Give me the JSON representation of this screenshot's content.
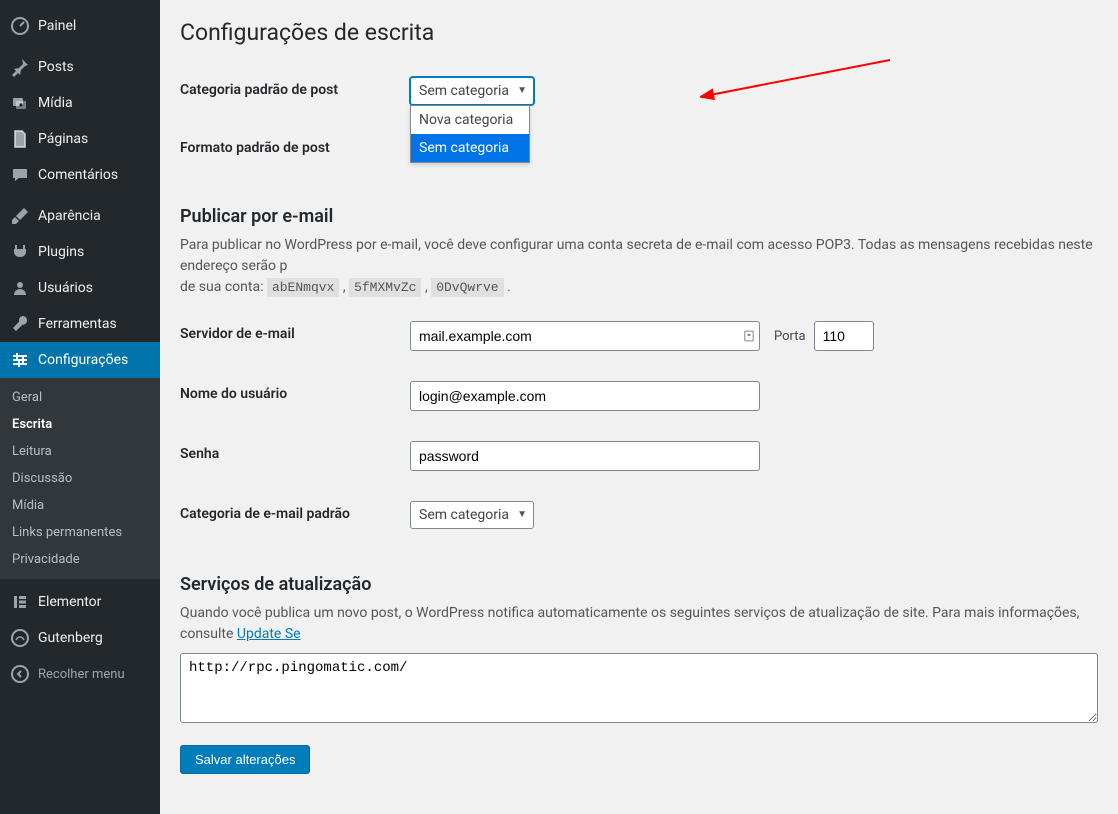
{
  "sidebar": {
    "items": [
      {
        "label": "Painel",
        "icon": "dashboard-icon"
      },
      {
        "label": "Posts",
        "icon": "pin-icon"
      },
      {
        "label": "Mídia",
        "icon": "media-icon"
      },
      {
        "label": "Páginas",
        "icon": "page-icon"
      },
      {
        "label": "Comentários",
        "icon": "comments-icon"
      },
      {
        "label": "Aparência",
        "icon": "brush-icon"
      },
      {
        "label": "Plugins",
        "icon": "plug-icon"
      },
      {
        "label": "Usuários",
        "icon": "users-icon"
      },
      {
        "label": "Ferramentas",
        "icon": "tools-icon"
      },
      {
        "label": "Configurações",
        "icon": "settings-icon",
        "current": true
      },
      {
        "label": "Elementor",
        "icon": "elementor-icon"
      },
      {
        "label": "Gutenberg",
        "icon": "gutenberg-icon"
      }
    ],
    "submenu": [
      "Geral",
      "Escrita",
      "Leitura",
      "Discussão",
      "Mídia",
      "Links permanentes",
      "Privacidade"
    ],
    "submenu_current": "Escrita",
    "collapse_label": "Recolher menu"
  },
  "page": {
    "title": "Configurações de escrita",
    "row1_label": "Categoria padrão de post",
    "row2_label": "Formato padrão de post",
    "default_category_selected": "Sem categoria",
    "default_category_options": [
      "Nova categoria",
      "Sem categoria"
    ],
    "section_email_title": "Publicar por e-mail",
    "section_email_desc_prefix": "Para publicar no WordPress por e-mail, você deve configurar uma conta secreta de e-mail com acesso POP3. Todas as mensagens recebidas neste endereço serão p",
    "section_email_desc_middle": "de sua conta:",
    "random_codes": [
      "abENmqvx",
      "5fMXMvZc",
      "0DvQwrve"
    ],
    "row_server_label": "Servidor de e-mail",
    "server_value": "mail.example.com",
    "port_label": "Porta",
    "port_value": "110",
    "row_user_label": "Nome do usuário",
    "user_value": "login@example.com",
    "row_pass_label": "Senha",
    "pass_value": "password",
    "row_email_cat_label": "Categoria de e-mail padrão",
    "email_cat_selected": "Sem categoria",
    "section_update_title": "Serviços de atualização",
    "section_update_desc": "Quando você publica um novo post, o WordPress notifica automaticamente os seguintes serviços de atualização de site. Para mais informações, consulte",
    "section_update_link": "Update Se",
    "ping_sites": "http://rpc.pingomatic.com/",
    "save_label": "Salvar alterações"
  }
}
